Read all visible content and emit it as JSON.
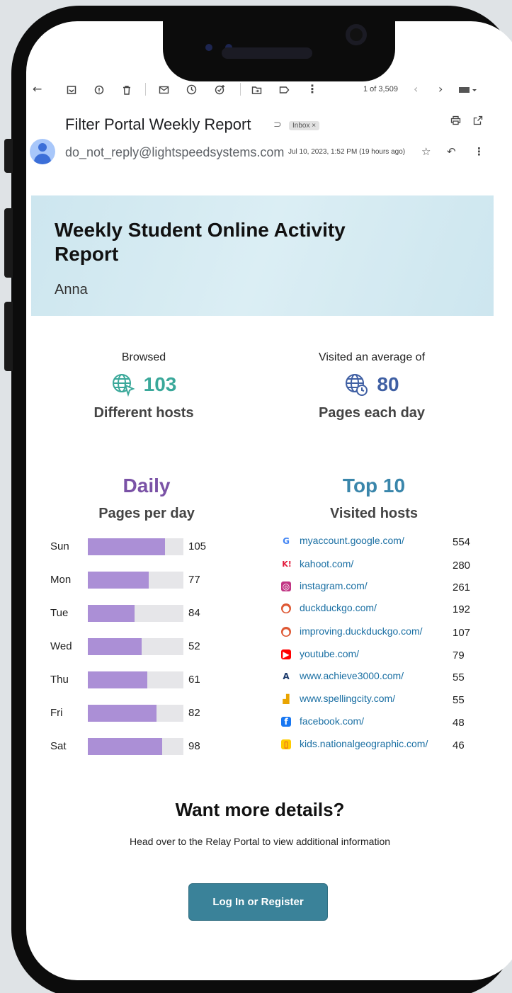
{
  "toolbar": {
    "icons": [
      "back-arrow-icon",
      "archive-icon",
      "report-spam-icon",
      "delete-icon",
      "mark-unread-icon",
      "snooze-icon",
      "add-task-icon",
      "move-to-icon",
      "label-icon",
      "more-icon"
    ],
    "count": "1 of 3,509"
  },
  "email": {
    "subject": "Filter Portal Weekly Report",
    "label": "Inbox ×",
    "sender": "do_not_reply@lightspeedsystems.com",
    "date": "Jul 10, 2023, 1:52 PM (19 hours ago)"
  },
  "report": {
    "title": "Weekly Student Online Activity Report",
    "student": "Anna",
    "browsed": {
      "caption": "Browsed",
      "value": "103",
      "unit": "Different hosts",
      "color": "#3aa89a"
    },
    "visited": {
      "caption": "Visited an average of",
      "value": "80",
      "unit": "Pages each day",
      "color": "#3f5fa3"
    },
    "daily": {
      "heading": "Daily",
      "subheading": "Pages per day",
      "color": "#7a52a6"
    },
    "top": {
      "heading": "Top 10",
      "subheading": "Visited hosts",
      "color": "#3a86ab"
    }
  },
  "chart_data": {
    "type": "bar",
    "categories": [
      "Sun",
      "Mon",
      "Tue",
      "Wed",
      "Thu",
      "Fri",
      "Sat"
    ],
    "values": [
      105,
      77,
      84,
      52,
      61,
      82,
      98
    ],
    "fill_fraction": [
      0.81,
      0.64,
      0.49,
      0.56,
      0.62,
      0.72,
      0.78
    ],
    "color": "#ab8fd6"
  },
  "hosts": [
    {
      "name": "myaccount.google.com/",
      "visits": "554",
      "icon": "google-icon"
    },
    {
      "name": "kahoot.com/",
      "visits": "280",
      "icon": "kahoot-icon"
    },
    {
      "name": "instagram.com/",
      "visits": "261",
      "icon": "instagram-icon"
    },
    {
      "name": "duckduckgo.com/",
      "visits": "192",
      "icon": "duckduckgo-icon"
    },
    {
      "name": "improving.duckduckgo.com/",
      "visits": "107",
      "icon": "duckduckgo-icon"
    },
    {
      "name": "youtube.com/",
      "visits": "79",
      "icon": "youtube-icon"
    },
    {
      "name": "www.achieve3000.com/",
      "visits": "55",
      "icon": "achieve3000-icon"
    },
    {
      "name": "www.spellingcity.com/",
      "visits": "55",
      "icon": "spellingcity-icon"
    },
    {
      "name": "facebook.com/",
      "visits": "48",
      "icon": "facebook-icon"
    },
    {
      "name": "kids.nationalgeographic.com/",
      "visits": "46",
      "icon": "natgeo-icon"
    }
  ],
  "footer": {
    "title": "Want more details?",
    "subtitle": "Head over to the Relay Portal to view additional information",
    "button": "Log In or Register"
  }
}
